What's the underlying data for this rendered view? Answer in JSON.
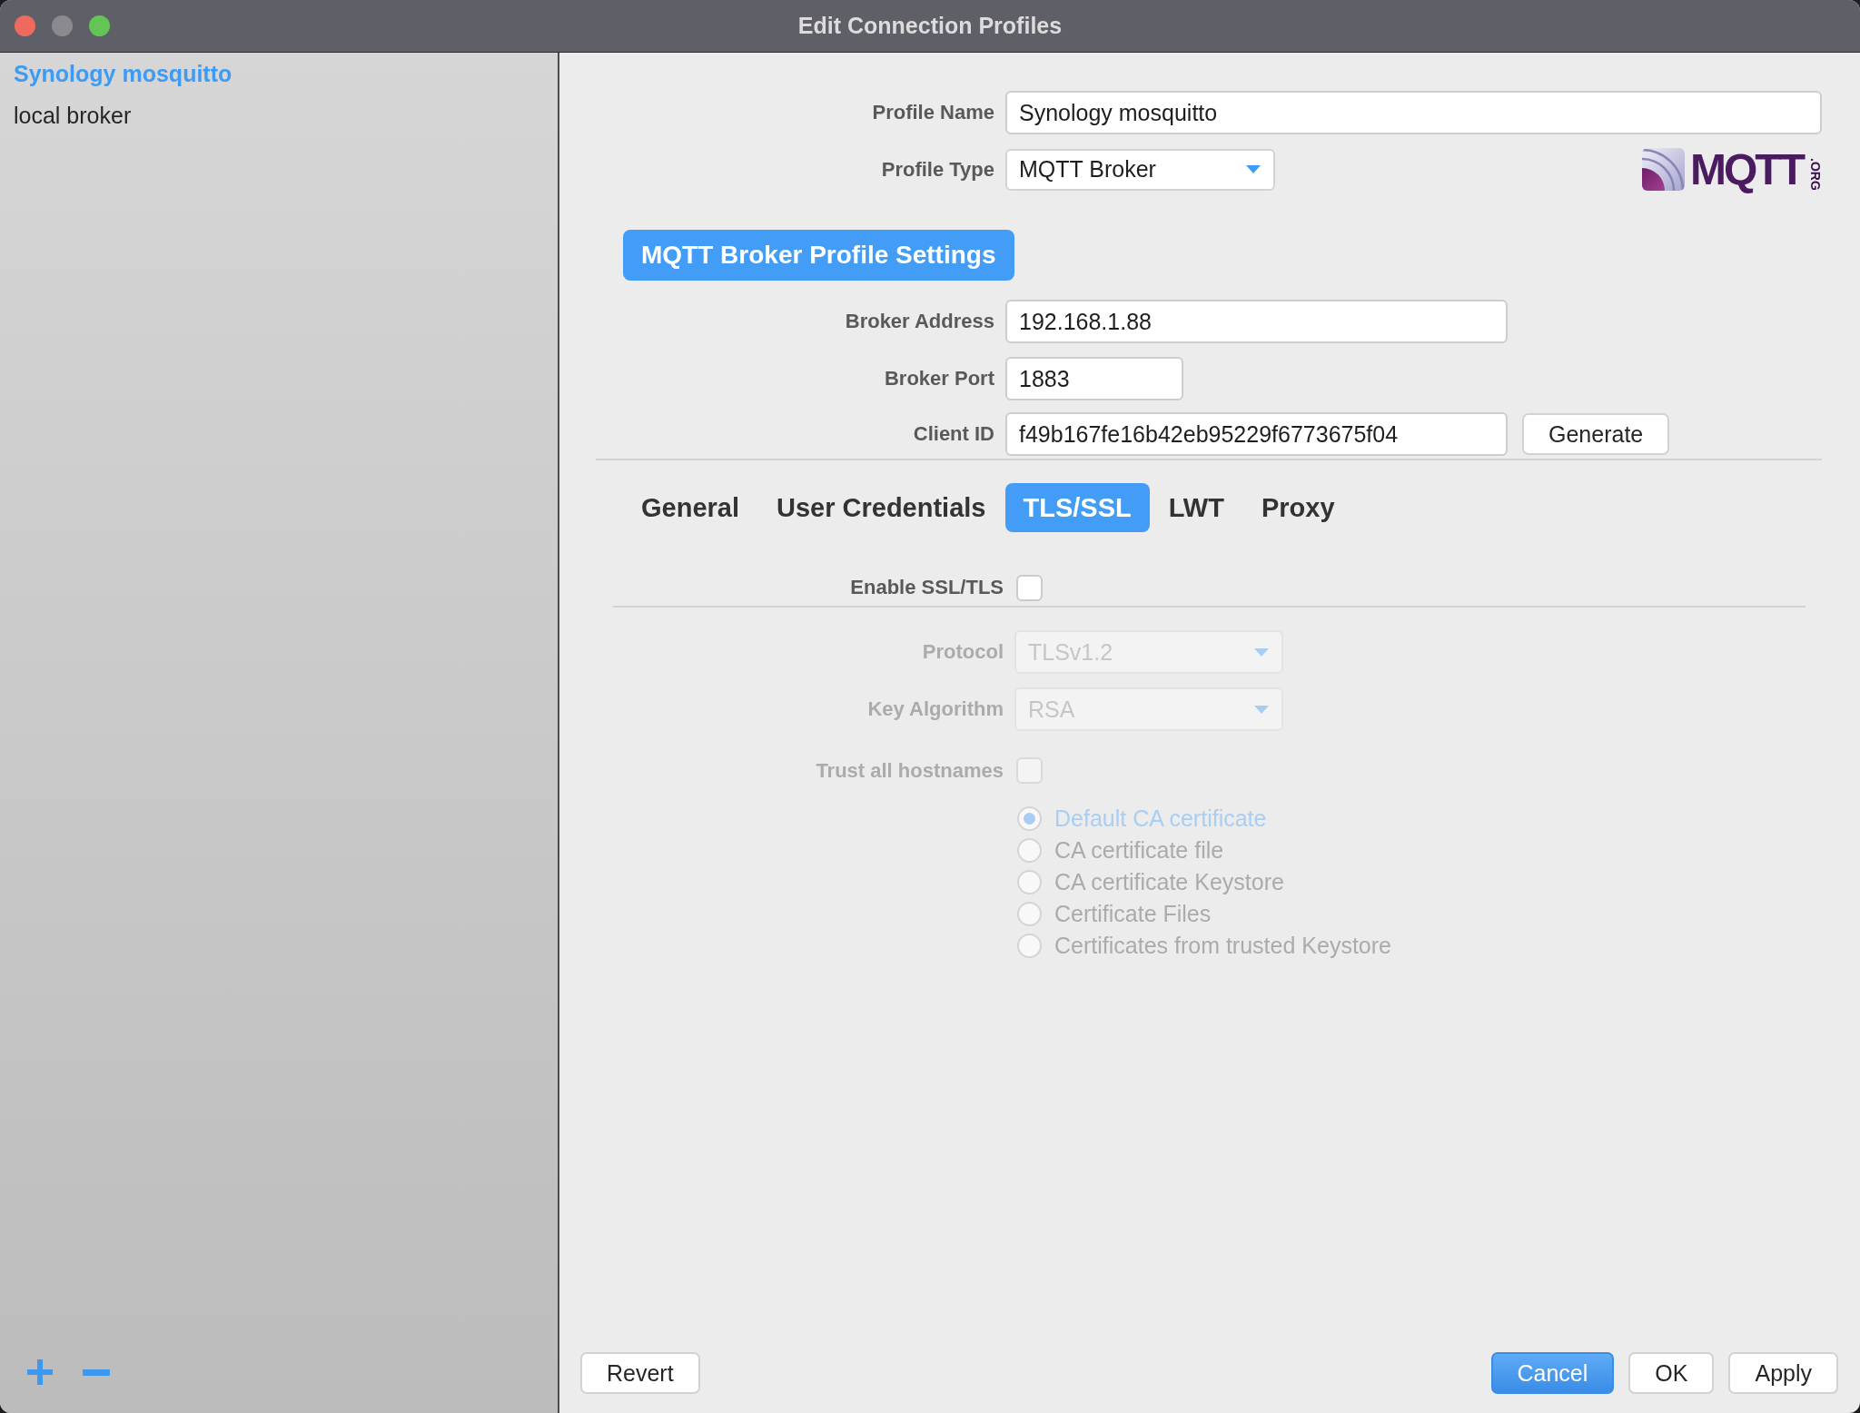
{
  "window": {
    "title": "Edit Connection Profiles"
  },
  "sidebar": {
    "profiles": [
      {
        "name": "Synology mosquitto",
        "selected": true
      },
      {
        "name": "local broker",
        "selected": false
      }
    ]
  },
  "profile": {
    "name": {
      "label": "Profile Name",
      "value": "Synology mosquitto"
    },
    "type": {
      "label": "Profile Type",
      "value": "MQTT Broker"
    },
    "logo": {
      "text": "MQTT",
      "suffix": ".ORG"
    }
  },
  "broker": {
    "heading": "MQTT Broker Profile Settings",
    "address": {
      "label": "Broker Address",
      "value": "192.168.1.88"
    },
    "port": {
      "label": "Broker Port",
      "value": "1883"
    },
    "client_id": {
      "label": "Client ID",
      "value": "f49b167fe16b42eb95229f6773675f04",
      "button": "Generate"
    }
  },
  "tabs": [
    {
      "label": "General",
      "selected": false
    },
    {
      "label": "User Credentials",
      "selected": false
    },
    {
      "label": "TLS/SSL",
      "selected": true
    },
    {
      "label": "LWT",
      "selected": false
    },
    {
      "label": "Proxy",
      "selected": false
    }
  ],
  "tls": {
    "enable": {
      "label": "Enable SSL/TLS",
      "checked": false
    },
    "protocol": {
      "label": "Protocol",
      "value": "TLSv1.2",
      "disabled": true
    },
    "key_algorithm": {
      "label": "Key Algorithm",
      "value": "RSA",
      "disabled": true
    },
    "trust_all_hostnames": {
      "label": "Trust all hostnames",
      "checked": false,
      "disabled": true
    },
    "ca_options": [
      {
        "label": "Default CA certificate",
        "selected": true,
        "disabled": true
      },
      {
        "label": "CA certificate file",
        "selected": false,
        "disabled": true
      },
      {
        "label": "CA certificate Keystore",
        "selected": false,
        "disabled": true
      },
      {
        "label": "Certificate Files",
        "selected": false,
        "disabled": true
      },
      {
        "label": "Certificates from trusted Keystore",
        "selected": false,
        "disabled": true
      }
    ]
  },
  "footer": {
    "left": [
      {
        "label": "Revert",
        "default": false
      }
    ],
    "right": [
      {
        "label": "Cancel",
        "default": true
      },
      {
        "label": "OK",
        "default": false
      },
      {
        "label": "Apply",
        "default": false
      }
    ]
  }
}
